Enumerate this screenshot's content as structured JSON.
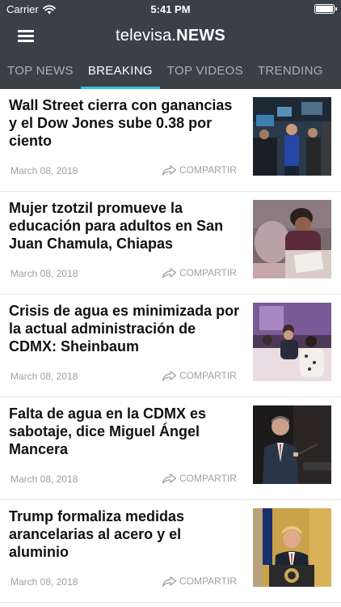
{
  "status_bar": {
    "carrier": "Carrier",
    "time": "5:41 PM"
  },
  "nav": {
    "logo_light": "televisa.",
    "logo_bold": "NEWS"
  },
  "tabs": [
    {
      "label": "TOP NEWS"
    },
    {
      "label": "BREAKING"
    },
    {
      "label": "TOP VIDEOS"
    },
    {
      "label": "TRENDING"
    }
  ],
  "articles": [
    {
      "title": "Wall Street cierra con ganancias y el Dow Jones sube 0.38 por ciento",
      "date": "March 08, 2018",
      "share_label": "COMPARTIR"
    },
    {
      "title": "Mujer tzotzil promueve la educación para adultos en San Juan Chamula, Chiapas",
      "date": "March 08, 2018",
      "share_label": "COMPARTIR"
    },
    {
      "title": "Crisis de agua es minimizada por la actual administración de CDMX: Sheinbaum",
      "date": "March 08, 2018",
      "share_label": "COMPARTIR"
    },
    {
      "title": "Falta de agua en la CDMX es sabotaje, dice Miguel Ángel Mancera",
      "date": "March 08, 2018",
      "share_label": "COMPARTIR"
    },
    {
      "title": "Trump formaliza medidas arancelarias al acero y el aluminio",
      "date": "March 08, 2018",
      "share_label": "COMPARTIR"
    }
  ],
  "colors": {
    "header_bg": "#3a4146",
    "tab_indicator": "#2fc1d8",
    "tab_inactive": "#aab0b4",
    "meta_text": "#a0a0a0"
  }
}
